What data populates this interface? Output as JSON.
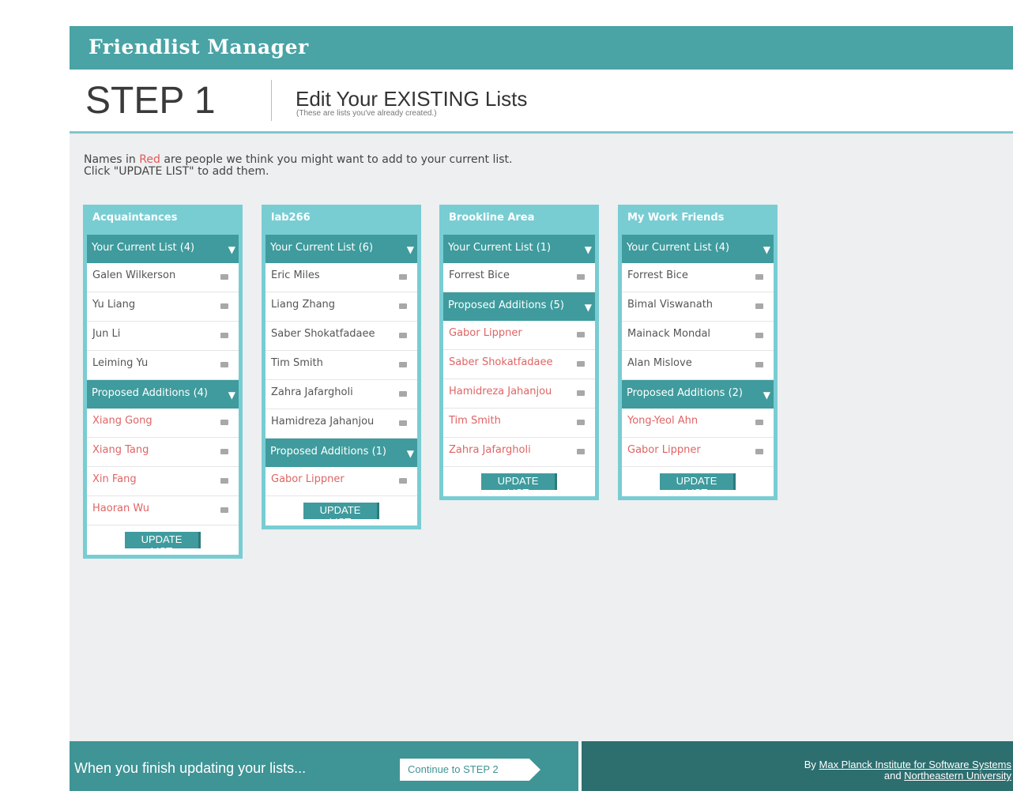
{
  "app": {
    "title": "Friendlist Manager"
  },
  "step": {
    "number": "STEP 1",
    "title": "Edit Your EXISTING Lists",
    "subtitle": "(These are lists you've already created.)"
  },
  "intro": {
    "line1_pre": "Names in ",
    "line1_red": "Red",
    "line1_post": " are people we think you might want to add to your current list.",
    "line2": "Click \"UPDATE LIST\" to add them."
  },
  "update_label": "UPDATE LIST",
  "lists": [
    {
      "name": "Acquaintances",
      "current_label": "Your Current List (4)",
      "current": [
        "Galen Wilkerson",
        "Yu Liang",
        "Jun Li",
        "Leiming Yu"
      ],
      "proposed_label": "Proposed Additions (4)",
      "proposed": [
        "Xiang Gong",
        "Xiang Tang",
        "Xin Fang",
        "Haoran Wu"
      ]
    },
    {
      "name": "lab266",
      "current_label": "Your Current List (6)",
      "current": [
        "Eric Miles",
        "Liang Zhang",
        "Saber Shokatfadaee",
        "Tim Smith",
        "Zahra Jafargholi",
        "Hamidreza Jahanjou"
      ],
      "proposed_label": "Proposed Additions (1)",
      "proposed": [
        "Gabor Lippner"
      ]
    },
    {
      "name": "Brookline Area",
      "current_label": "Your Current List (1)",
      "current": [
        "Forrest Bice"
      ],
      "proposed_label": "Proposed Additions (5)",
      "proposed": [
        "Gabor Lippner",
        "Saber Shokatfadaee",
        "Hamidreza Jahanjou",
        "Tim Smith",
        "Zahra Jafargholi"
      ]
    },
    {
      "name": "My Work Friends",
      "current_label": "Your Current List (4)",
      "current": [
        "Forrest Bice",
        "Bimal Viswanath",
        "Mainack Mondal",
        "Alan Mislove"
      ],
      "proposed_label": "Proposed Additions (2)",
      "proposed": [
        "Yong-Yeol Ahn",
        "Gabor Lippner"
      ]
    }
  ],
  "footer": {
    "finish_text": "When you finish updating your lists...",
    "continue_label": "Continue to STEP 2",
    "credits_by": "By ",
    "credits_org1": "Max Planck Institute for Software Systems",
    "credits_and": "and ",
    "credits_org2": "Northeastern University"
  },
  "colors": {
    "accent": "#4aa3a5",
    "section": "#3f9b9d",
    "list_border": "#78cdd3",
    "proposed_text": "#e06464"
  }
}
